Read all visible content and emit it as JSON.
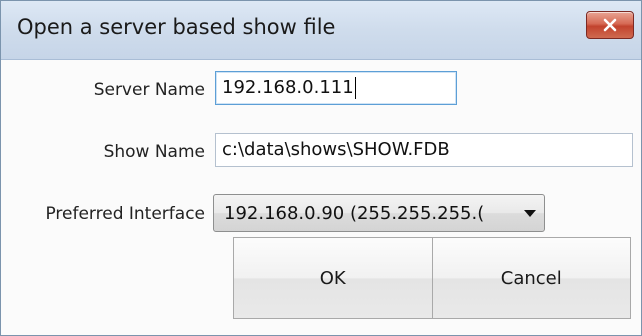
{
  "dialog": {
    "title": "Open a server based show file",
    "close_icon": "close-icon"
  },
  "form": {
    "server_name": {
      "label": "Server Name",
      "value": "192.168.0.111"
    },
    "show_name": {
      "label": "Show Name",
      "value": "c:\\data\\shows\\SHOW.FDB"
    },
    "preferred_interface": {
      "label": "Preferred Interface",
      "selected": "192.168.0.90 (255.255.255.("
    }
  },
  "buttons": {
    "ok_label": "OK",
    "cancel_label": "Cancel"
  },
  "colors": {
    "titlebar": "#cfdcec",
    "close_button": "#c2432e",
    "focus_border": "#5d9fd6"
  }
}
